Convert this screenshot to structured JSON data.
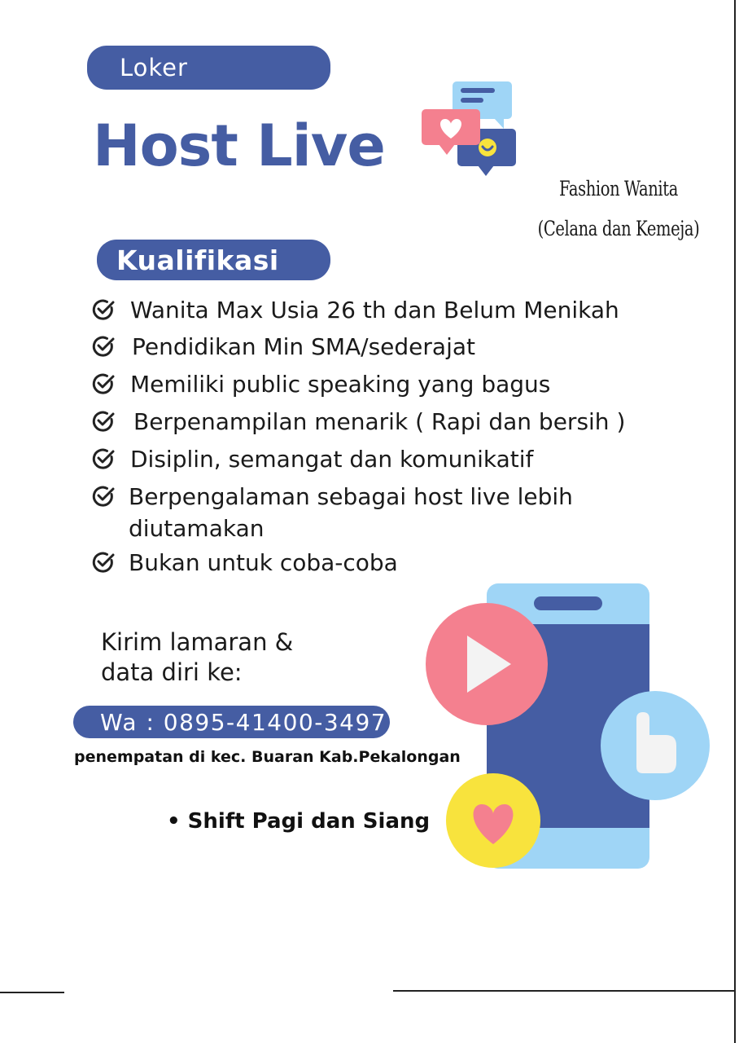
{
  "header": {
    "tag": "Loker",
    "title": "Host Live"
  },
  "sidebar_note": {
    "line1": "Fashion Wanita",
    "line2": "(Celana dan Kemeja)"
  },
  "qualifications": {
    "heading": "Kualifikasi",
    "items": [
      {
        "text": "Wanita Max Usia 26 th dan Belum Menikah"
      },
      {
        "text": "Pendidikan Min SMA/sederajat"
      },
      {
        "text": "Memiliki public speaking yang bagus"
      },
      {
        "text": "Berpenampilan menarik ( Rapi dan bersih )"
      },
      {
        "text": "Disiplin, semangat dan komunikatif"
      },
      {
        "text_line1": "Berpengalaman sebagai host live lebih",
        "text_line2": "diutamakan"
      },
      {
        "text": "Bukan untuk coba-coba"
      }
    ]
  },
  "contact": {
    "intro_line1": "Kirim lamaran &",
    "intro_line2": "data diri ke:",
    "whatsapp": "Wa : 0895-41400-3497",
    "placement": "penempatan di kec. Buaran Kab.Pekalongan",
    "shift": "• Shift Pagi dan Siang"
  },
  "colors": {
    "primary": "#455da3",
    "light_blue": "#9fd5f6",
    "pink": "#f4808f",
    "yellow": "#f8e33d"
  },
  "icons": [
    "check-circle-icon",
    "chat-bubbles-icon",
    "smartphone-icon",
    "play-icon",
    "like-icon",
    "heart-icon"
  ]
}
